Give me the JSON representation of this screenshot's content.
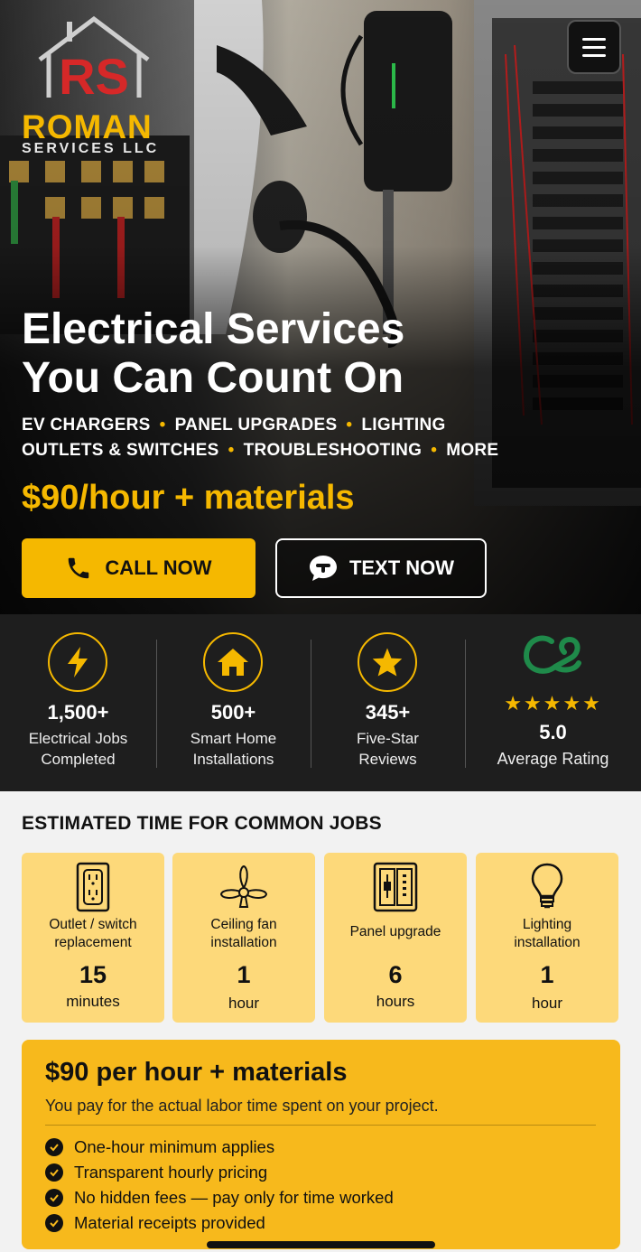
{
  "brand": {
    "initials": "RS",
    "name": "ROMAN",
    "suffix": "SERVICES LLC"
  },
  "hero": {
    "title_line1": "Electrical Services",
    "title_line2": "You Can Count On",
    "services_row1": [
      "EV CHARGERS",
      "PANEL UPGRADES",
      "LIGHTING"
    ],
    "services_row2": [
      "OUTLETS & SWITCHES",
      "TROUBLESHOOTING",
      "MORE"
    ],
    "price": "$90/hour + materials",
    "call_label": "CALL NOW",
    "text_label": "TEXT NOW"
  },
  "stats": [
    {
      "icon": "lightning-icon",
      "number": "1,500+",
      "label_line1": "Electrical Jobs",
      "label_line2": "Completed"
    },
    {
      "icon": "house-icon",
      "number": "500+",
      "label_line1": "Smart Home",
      "label_line2": "Installations"
    },
    {
      "icon": "star-icon",
      "number": "345+",
      "label_line1": "Five-Star",
      "label_line2": "Reviews"
    },
    {
      "icon": "review-logo-icon",
      "stars": "★★★★★",
      "rating": "5.0",
      "label": "Average Rating"
    }
  ],
  "estimates": {
    "title": "ESTIMATED TIME FOR COMMON JOBS",
    "jobs": [
      {
        "icon": "outlet-icon",
        "name_line1": "Outlet / switch",
        "name_line2": "replacement",
        "value": "15",
        "unit": "minutes"
      },
      {
        "icon": "ceiling-fan-icon",
        "name_line1": "Ceiling fan",
        "name_line2": "installation",
        "value": "1",
        "unit": "hour"
      },
      {
        "icon": "panel-icon",
        "name_line1": "Panel upgrade",
        "name_line2": "",
        "value": "6",
        "unit": "hours"
      },
      {
        "icon": "lightbulb-icon",
        "name_line1": "Lighting",
        "name_line2": "installation",
        "value": "1",
        "unit": "hour"
      }
    ]
  },
  "pricing": {
    "title": "$90 per hour + materials",
    "subtitle": "You pay for the actual labor time spent on your project.",
    "items": [
      "One-hour minimum applies",
      "Transparent hourly pricing",
      "No hidden fees — pay only for time worked",
      "Material receipts provided"
    ]
  },
  "colors": {
    "accent": "#f5b800",
    "card": "#fdd97a",
    "dark": "#1e1e1e"
  }
}
